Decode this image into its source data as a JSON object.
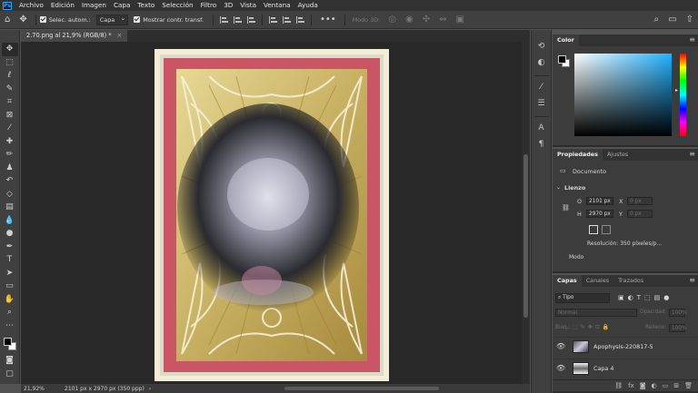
{
  "app": {
    "logo": "Ps"
  },
  "menu": [
    "Archivo",
    "Edición",
    "Imagen",
    "Capa",
    "Texto",
    "Selección",
    "Filtro",
    "3D",
    "Vista",
    "Ventana",
    "Ayuda"
  ],
  "options": {
    "auto_select_label": "Selec. autom.:",
    "layer_select_value": "Capa",
    "transform_label": "Mostrar contr. transf.",
    "mode3d_label": "Modo 3D:",
    "more": "•••"
  },
  "document": {
    "tab_title": "2.70.png al 21,9% (RGB/8) *",
    "tab_close": "×"
  },
  "status": {
    "zoom": "21,92%",
    "doc_info": "2101 px x 2970 px (350 ppp)"
  },
  "panels": {
    "color": {
      "tab": "Color"
    },
    "properties": {
      "tabs": [
        "Propiedades",
        "Ajustes"
      ],
      "doc_label": "Documento",
      "section": "Lienzo",
      "width_label": "O",
      "width_value": "2101 px",
      "x_label": "X",
      "x_placeholder": "0 px",
      "height_label": "H",
      "height_value": "2970 px",
      "y_label": "Y",
      "y_placeholder": "0 px",
      "resolution": "Resolución:  350  píxeles/p...",
      "mode_label": "Modo"
    },
    "layers": {
      "tabs": [
        "Capas",
        "Canales",
        "Trazados"
      ],
      "filter_value": "Tipo",
      "blend_mode": "Normal",
      "opacity_label": "Opacidad:",
      "opacity_value": "100%",
      "lock_label": "Bloq.:",
      "fill_label": "Relleno:",
      "fill_value": "100%",
      "items": [
        {
          "name": "Apophysis-220817-5"
        },
        {
          "name": "Capa 4"
        }
      ]
    }
  },
  "colors": {
    "accent": "#31a8ff",
    "foreground": "#000000",
    "background": "#ffffff"
  }
}
